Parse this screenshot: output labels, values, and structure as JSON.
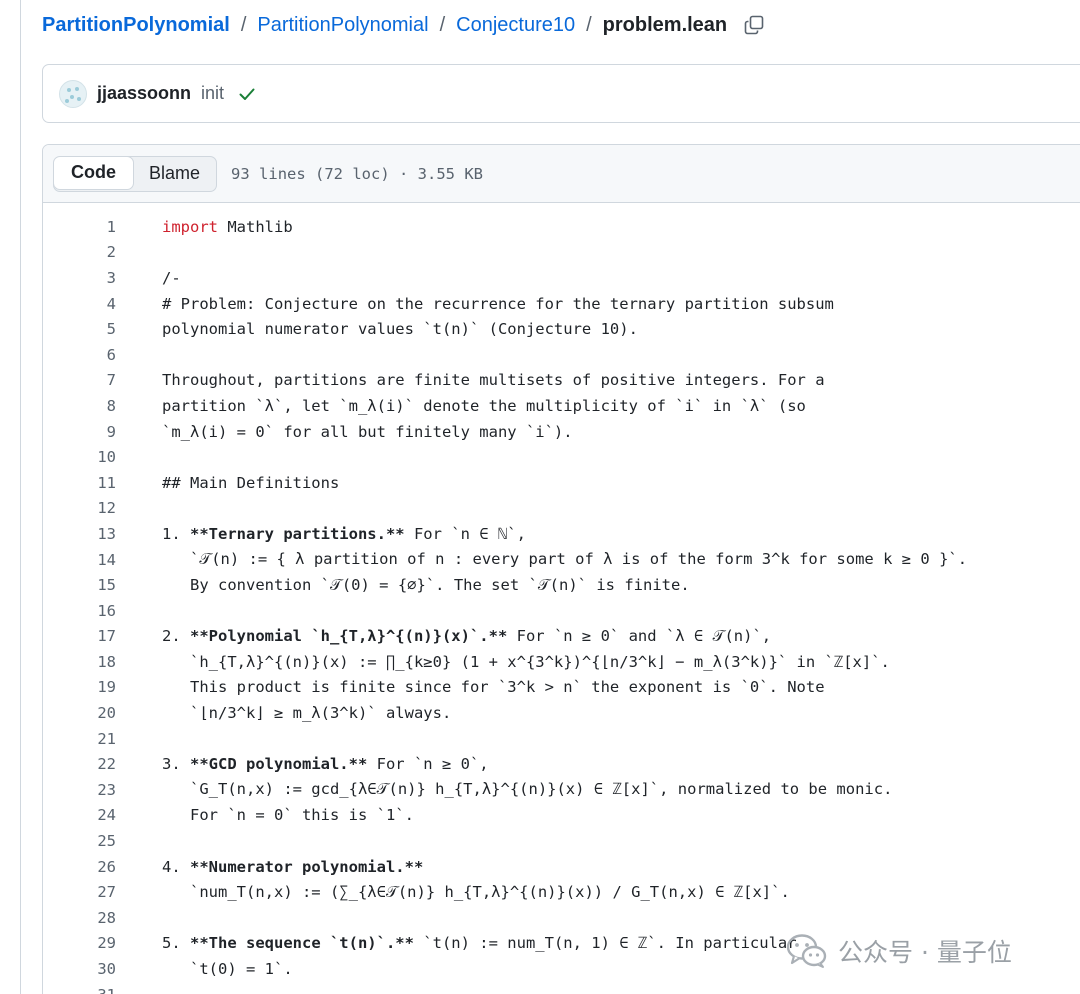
{
  "breadcrumb": {
    "repo_owner": "PartitionPolynomial",
    "repo": "PartitionPolynomial",
    "folder": "Conjecture10",
    "file": "problem.lean",
    "separator": "/",
    "copy_icon": "copy-icon"
  },
  "commit": {
    "author": "jjaassoonn",
    "message": "init",
    "status_icon": "check-icon",
    "status_color": "#1a7f37"
  },
  "file_view": {
    "tabs": [
      {
        "label": "Code",
        "active": true
      },
      {
        "label": "Blame",
        "active": false
      }
    ],
    "meta": "93 lines (72 loc) · 3.55 KB"
  },
  "code": {
    "lines": [
      {
        "num": "1",
        "text": "import Mathlib"
      },
      {
        "num": "2",
        "text": ""
      },
      {
        "num": "3",
        "text": "/-"
      },
      {
        "num": "4",
        "text": "# Problem: Conjecture on the recurrence for the ternary partition subsum"
      },
      {
        "num": "5",
        "text": "polynomial numerator values `t(n)` (Conjecture 10)."
      },
      {
        "num": "6",
        "text": ""
      },
      {
        "num": "7",
        "text": "Throughout, partitions are finite multisets of positive integers. For a"
      },
      {
        "num": "8",
        "text": "partition `λ`, let `m_λ(i)` denote the multiplicity of `i` in `λ` (so"
      },
      {
        "num": "9",
        "text": "`m_λ(i) = 0` for all but finitely many `i`)."
      },
      {
        "num": "10",
        "text": ""
      },
      {
        "num": "11",
        "text": "## Main Definitions"
      },
      {
        "num": "12",
        "text": ""
      },
      {
        "num": "13",
        "text": "1. **Ternary partitions.** For `n ∈ ℕ`,"
      },
      {
        "num": "14",
        "text": "   `𝒯(n) := { λ partition of n : every part of λ is of the form 3^k for some k ≥ 0 }`."
      },
      {
        "num": "15",
        "text": "   By convention `𝒯(0) = {∅}`. The set `𝒯(n)` is finite."
      },
      {
        "num": "16",
        "text": ""
      },
      {
        "num": "17",
        "text": "2. **Polynomial `h_{T,λ}^{(n)}(x)`.** For `n ≥ 0` and `λ ∈ 𝒯(n)`,"
      },
      {
        "num": "18",
        "text": "   `h_{T,λ}^{(n)}(x) := ∏_{k≥0} (1 + x^{3^k})^{⌊n/3^k⌋ − m_λ(3^k)}` in `ℤ[x]`."
      },
      {
        "num": "19",
        "text": "   This product is finite since for `3^k > n` the exponent is `0`. Note"
      },
      {
        "num": "20",
        "text": "   `⌊n/3^k⌋ ≥ m_λ(3^k)` always."
      },
      {
        "num": "21",
        "text": ""
      },
      {
        "num": "22",
        "text": "3. **GCD polynomial.** For `n ≥ 0`,"
      },
      {
        "num": "23",
        "text": "   `G_T(n,x) := gcd_{λ∈𝒯(n)} h_{T,λ}^{(n)}(x) ∈ ℤ[x]`, normalized to be monic."
      },
      {
        "num": "24",
        "text": "   For `n = 0` this is `1`."
      },
      {
        "num": "25",
        "text": ""
      },
      {
        "num": "26",
        "text": "4. **Numerator polynomial.**"
      },
      {
        "num": "27",
        "text": "   `num_T(n,x) := (∑_{λ∈𝒯(n)} h_{T,λ}^{(n)}(x)) / G_T(n,x) ∈ ℤ[x]`."
      },
      {
        "num": "28",
        "text": ""
      },
      {
        "num": "29",
        "text": "5. **The sequence `t(n)`.** `t(n) := num_T(n, 1) ∈ ℤ`. In particular"
      },
      {
        "num": "30",
        "text": "   `t(0) = 1`."
      },
      {
        "num": "31",
        "text": ""
      }
    ],
    "keyword_color": "#cf222e"
  },
  "watermark": {
    "icon": "wechat-icon",
    "text": "公众号 · 量子位"
  }
}
